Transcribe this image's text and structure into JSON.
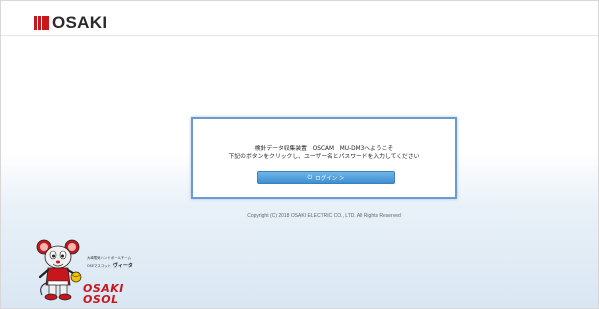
{
  "brand": {
    "name": "OSAKI",
    "accent_color": "#c8161d"
  },
  "login_panel": {
    "welcome_line1": "検針データ収集装置　OSCAM　MU-DM3へようこそ",
    "welcome_line2": "下記のボタンをクリックし、ユーザー名とパスワードを入力してください",
    "login_button": {
      "icon": "power-icon",
      "label": "ログイン ＞"
    },
    "border_color": "#6a9bd0",
    "button_color": "#4a9ad8"
  },
  "footer": {
    "copyright": "Copyright (C) 2018 OSAKI ELECTRIC CO., LTD. All Rights Reserved"
  },
  "mascot": {
    "caption_line1": "大崎電気ハンドボールチーム",
    "caption_line2": "OSEマスコット",
    "name": "ヴィータ",
    "logo_line1": "OSAKI",
    "logo_line2": "OSOL"
  }
}
